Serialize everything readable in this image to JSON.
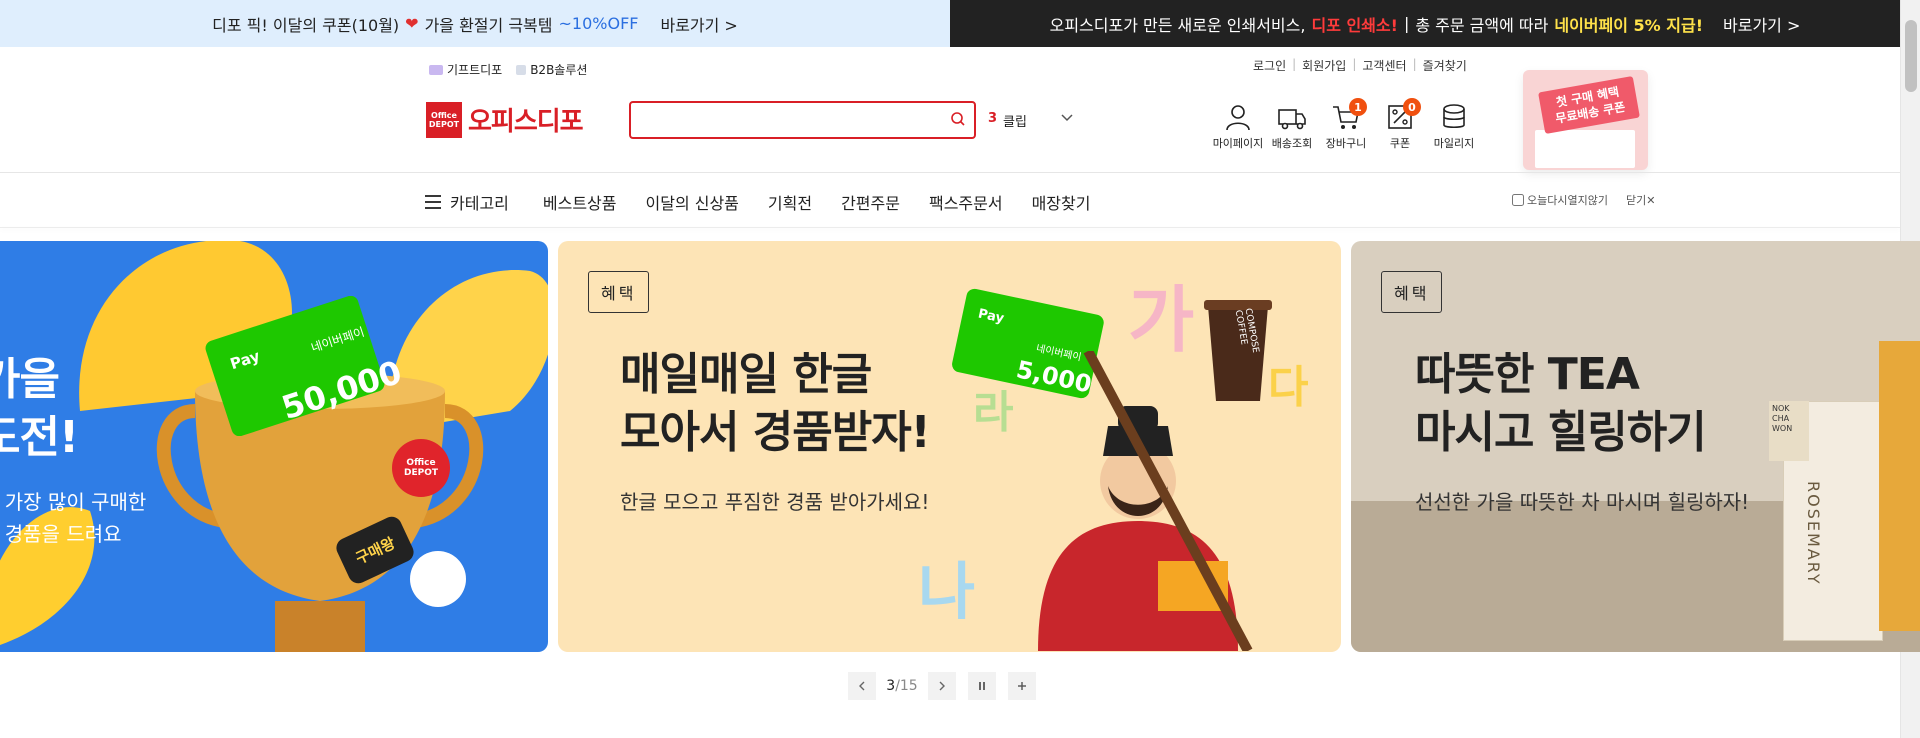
{
  "promo": {
    "left_text": "디포 픽! 이달의 쿠폰(10월)",
    "left_text2": "가을 환절기 극복템",
    "left_off": "~10%OFF",
    "left_go": "바로가기 >",
    "right_text": "오피스디포가 만든 새로운 인쇄서비스,",
    "right_highlight": "디포 인쇄소!",
    "right_sep": "|",
    "right_text2": "총 주문 금액에 따라",
    "right_highlight2": "네이버페이 5% 지급!",
    "right_go": "바로가기 >"
  },
  "util": {
    "gift": "기프트디포",
    "b2b": "B2B솔루션",
    "login": "로그인",
    "join": "회원가입",
    "cs": "고객센터",
    "fav": "즐겨찾기"
  },
  "logo": {
    "box_text": "Office DEPOT",
    "text": "오피스디포"
  },
  "search": {
    "value": "",
    "placeholder": ""
  },
  "rank": {
    "number": "3",
    "keyword": "클립"
  },
  "header_icons": [
    {
      "label": "마이페이지",
      "icon": "user-icon"
    },
    {
      "label": "배송조회",
      "icon": "truck-icon"
    },
    {
      "label": "장바구니",
      "icon": "cart-icon",
      "badge": "1"
    },
    {
      "label": "쿠폰",
      "icon": "coupon-icon",
      "badge": "0"
    },
    {
      "label": "마일리지",
      "icon": "coins-icon"
    }
  ],
  "first_coupon": {
    "line1": "첫 구매 혜택",
    "line2": "무료배송 쿠폰"
  },
  "nav": {
    "category": "카테고리",
    "items": [
      "베스트상품",
      "이달의 신상품",
      "기획전",
      "간편주문",
      "팩스주문서",
      "매장찾기"
    ],
    "today_close": "오늘다시열지않기",
    "close": "닫기"
  },
  "banners": [
    {
      "title_line1": "가을",
      "title_line2": "도전!",
      "sub_line1": "을 가장 많이 구매한",
      "sub_line2": "로 경품을 드려요",
      "card_label": "네이버페이",
      "card_amount": "50,000",
      "card_pay": "Pay",
      "trophy_sticker": "구매왕",
      "trophy_logo": "Office DEPOT"
    },
    {
      "tag": "혜택",
      "title_line1": "매일매일 한글",
      "title_line2": "모아서 경품받자!",
      "sub": "한글 모으고 푸짐한 경품 받아가세요!",
      "card_label": "네이버페이",
      "card_amount": "5,000",
      "card_pay": "Pay",
      "letters": [
        "가",
        "라",
        "다",
        "나"
      ],
      "coffee": "COMPOSE COFFEE"
    },
    {
      "tag": "혜택",
      "title_line1": "따뜻한 TEA",
      "title_line2": "마시고 힐링하기",
      "sub": "선선한 가을 따뜻한 차 마시며 힐링하자!",
      "box_text": "ROSEMARY",
      "box_brand": "NOK CHA WON"
    }
  ],
  "pager": {
    "current": "3",
    "total": "/15"
  },
  "colors": {
    "brand_red": "#d91f26",
    "badge_orange": "#f0500f",
    "promo_left_bg": "#dfeefd",
    "promo_right_bg": "#222222",
    "banner1_bg": "#2f7de6",
    "banner2_bg": "#fde4b6",
    "banner3_bg": "#d9cfbf"
  }
}
